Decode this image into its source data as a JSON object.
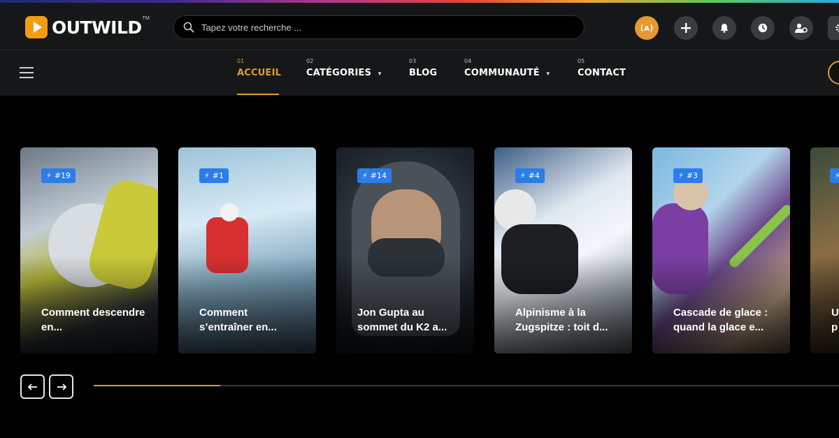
{
  "app": {
    "logo_text": "OUTWILD",
    "logo_tm": "TM"
  },
  "search": {
    "placeholder": "Tapez votre recherche ..."
  },
  "header_buttons": [
    {
      "name": "live-radio-button",
      "icon": "broadcast-icon",
      "label": "(A)"
    },
    {
      "name": "add-button",
      "icon": "plus-icon"
    },
    {
      "name": "notifications-button",
      "icon": "bell-icon"
    },
    {
      "name": "history-button",
      "icon": "clock-icon"
    },
    {
      "name": "account-button",
      "icon": "user-settings-icon"
    },
    {
      "name": "settings-button",
      "icon": "gear-icon"
    }
  ],
  "nav": {
    "items": [
      {
        "num": "01",
        "label": "ACCUEIL",
        "active": true,
        "dropdown": false
      },
      {
        "num": "02",
        "label": "CATÉGORIES",
        "active": false,
        "dropdown": true
      },
      {
        "num": "03",
        "label": "BLOG",
        "active": false,
        "dropdown": false
      },
      {
        "num": "04",
        "label": "COMMUNAUTÉ",
        "active": false,
        "dropdown": true
      },
      {
        "num": "05",
        "label": "CONTACT",
        "active": false,
        "dropdown": false
      }
    ],
    "caret": "▼"
  },
  "cards": [
    {
      "badge": "#19",
      "title": "Comment descendre en..."
    },
    {
      "badge": "#1",
      "title": "Comment s’entraîner en..."
    },
    {
      "badge": "#14",
      "title": "Jon Gupta au sommet du K2 a..."
    },
    {
      "badge": "#4",
      "title": "Alpinisme à la Zugspitze : toit d..."
    },
    {
      "badge": "#3",
      "title": "Cascade de glace : quand la glace e..."
    },
    {
      "badge": "",
      "title": "U p"
    }
  ],
  "slider": {
    "prev_label": "←",
    "next_label": "→",
    "progress_fraction": 0.17
  },
  "colors": {
    "accent": "#e39a2e",
    "badge": "#2b7de9",
    "bar": "#161719",
    "background": "#000000"
  }
}
